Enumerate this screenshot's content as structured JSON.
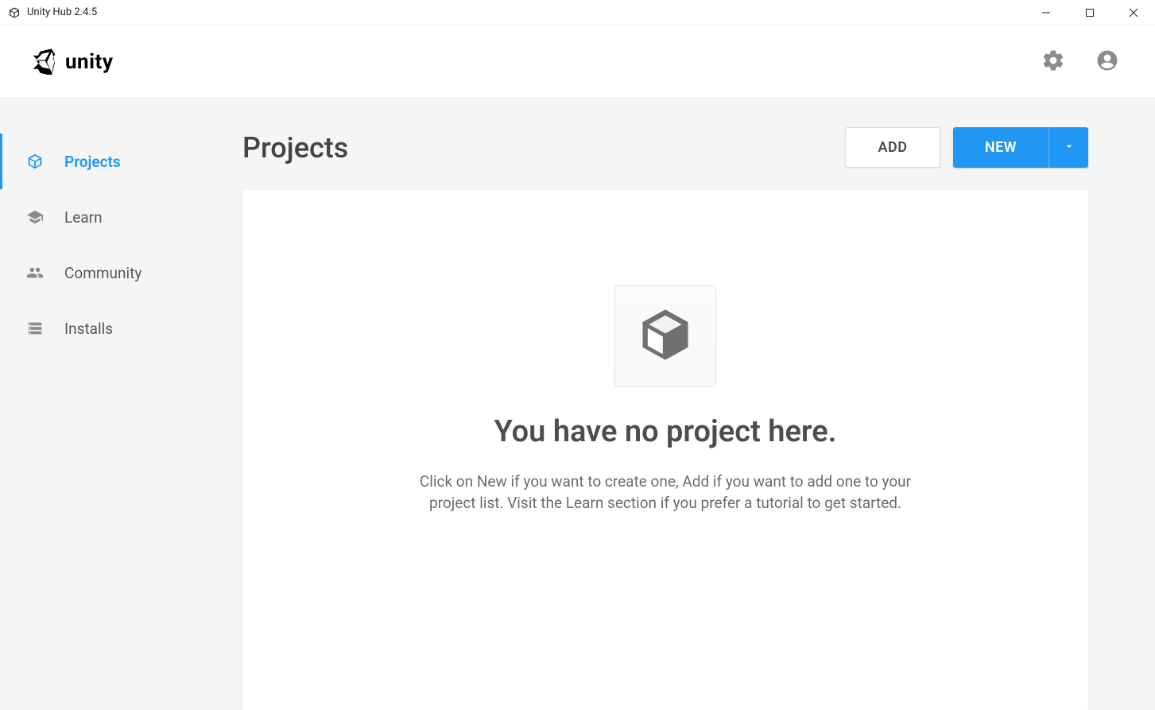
{
  "window": {
    "title": "Unity Hub 2.4.5"
  },
  "header": {
    "brand": "unity"
  },
  "sidebar": {
    "items": [
      {
        "label": "Projects"
      },
      {
        "label": "Learn"
      },
      {
        "label": "Community"
      },
      {
        "label": "Installs"
      }
    ]
  },
  "main": {
    "title": "Projects",
    "add_label": "ADD",
    "new_label": "NEW",
    "empty": {
      "heading": "You have no project here.",
      "description": "Click on New if you want to create one, Add if you want to add one to your project list. Visit the Learn section if you prefer a tutorial to get started."
    }
  }
}
